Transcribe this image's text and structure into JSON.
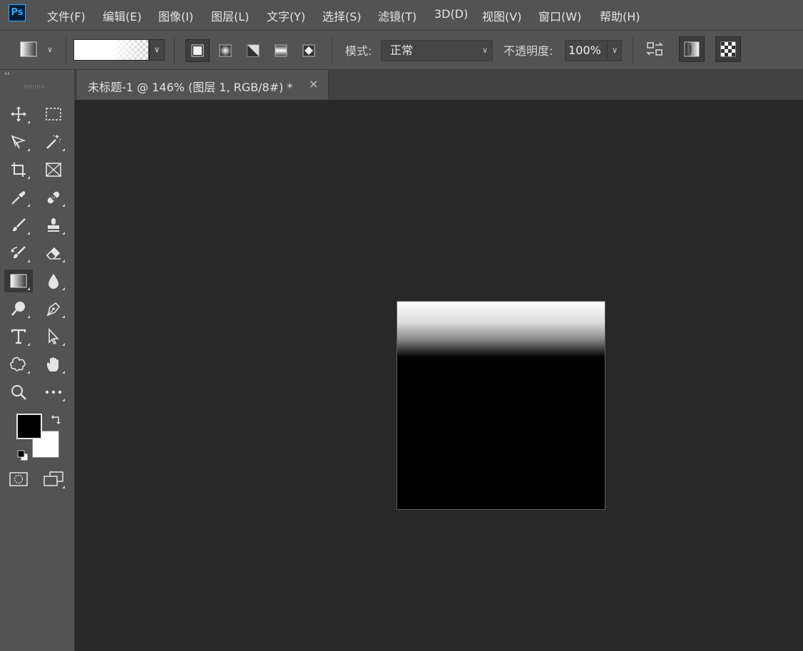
{
  "app": {
    "logo": "Ps"
  },
  "menu": [
    "文件(F)",
    "编辑(E)",
    "图像(I)",
    "图层(L)",
    "文字(Y)",
    "选择(S)",
    "滤镜(T)",
    "3D(D)",
    "视图(V)",
    "窗口(W)",
    "帮助(H)"
  ],
  "options": {
    "mode_label": "模式:",
    "mode_value": "正常",
    "opacity_label": "不透明度:",
    "opacity_value": "100%"
  },
  "document": {
    "tab_title": "未标题-1 @ 146% (图层 1, RGB/8#) *",
    "close_glyph": "×"
  },
  "toolbar": {
    "collapse_glyph": "‹‹"
  },
  "colors": {
    "foreground": "#000000",
    "background": "#ffffff",
    "ui_bg": "#535353",
    "workspace": "#282828",
    "accent": "#31a8ff"
  },
  "icons": {
    "options": [
      "gradient-tool-preset-icon",
      "linear-gradient-icon",
      "radial-gradient-icon",
      "angle-gradient-icon",
      "reflected-gradient-icon",
      "diamond-gradient-icon",
      "reverse-icon",
      "dither-icon",
      "transparency-icon"
    ],
    "tools": [
      "move-tool-icon",
      "marquee-tool-icon",
      "lasso-tool-icon",
      "magic-wand-icon",
      "crop-tool-icon",
      "frame-tool-icon",
      "eyedropper-icon",
      "healing-brush-icon",
      "brush-tool-icon",
      "clone-stamp-icon",
      "history-brush-icon",
      "eraser-icon",
      "gradient-tool-icon",
      "blur-tool-icon",
      "dodge-tool-icon",
      "pen-tool-icon",
      "type-tool-icon",
      "path-selection-icon",
      "custom-shape-icon",
      "hand-tool-icon",
      "zoom-tool-icon",
      "more-tools-icon"
    ]
  }
}
